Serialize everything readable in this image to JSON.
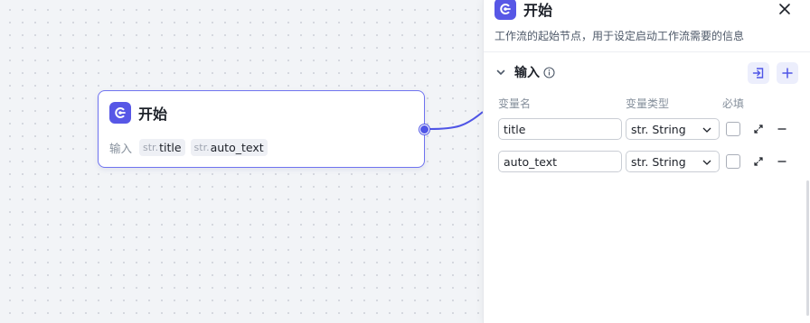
{
  "canvas": {
    "node": {
      "title": "开始",
      "icon": "start-flag-icon",
      "inputs_label": "输入",
      "variables": [
        {
          "type_prefix": "str.",
          "name": "title"
        },
        {
          "type_prefix": "str.",
          "name": "auto_text"
        }
      ]
    }
  },
  "panel": {
    "title": "开始",
    "icon": "start-flag-icon",
    "description": "工作流的起始节点，用于设定启动工作流需要的信息",
    "section": {
      "title": "输入",
      "columns": {
        "name": "变量名",
        "type": "变量类型",
        "required": "必填"
      },
      "rows": [
        {
          "name": "title",
          "type": "str. String",
          "required": false
        },
        {
          "name": "auto_text",
          "type": "str. String",
          "required": false
        }
      ]
    }
  },
  "colors": {
    "accent": "#5757e6",
    "node_border": "#6f73f0",
    "canvas_bg": "#f2f4f7"
  }
}
